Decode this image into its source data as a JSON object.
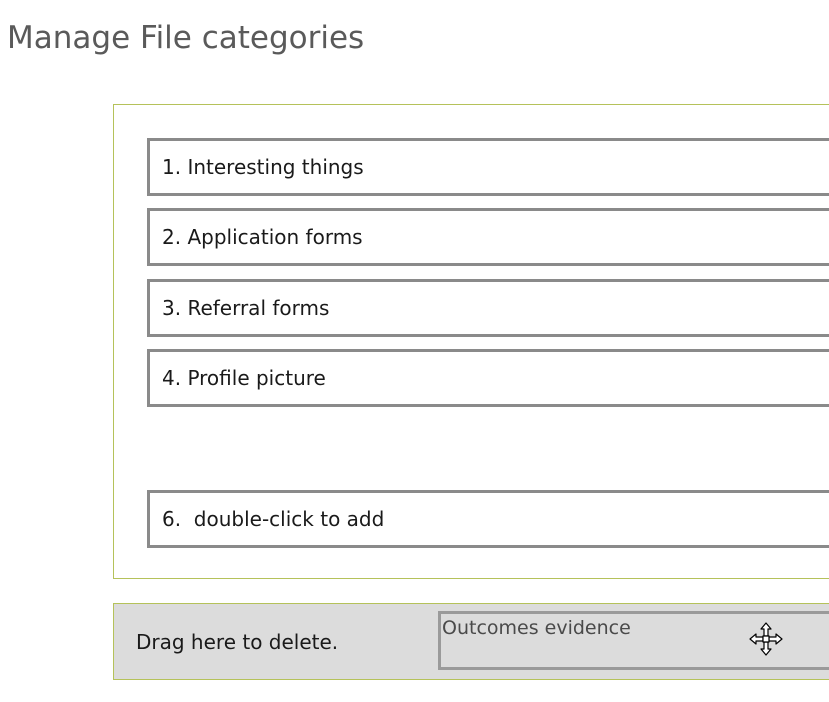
{
  "page": {
    "title": "Manage File categories"
  },
  "categories": {
    "items": [
      {
        "label": "1. Interesting things"
      },
      {
        "label": "2. Application forms"
      },
      {
        "label": "3. Referral forms"
      },
      {
        "label": "4. Profile picture"
      },
      {
        "label": "6.  double-click to add"
      }
    ]
  },
  "delete_zone": {
    "label": "Drag here to delete.",
    "dragged_item_label": "Outcomes evidence"
  },
  "colors": {
    "panel_border": "#b5c25a",
    "item_border": "#8a8a8a",
    "delete_zone_bg": "#dcdcdc",
    "title_text": "#5a5a5a"
  },
  "icons": {
    "cursor": "move-cursor-icon"
  }
}
